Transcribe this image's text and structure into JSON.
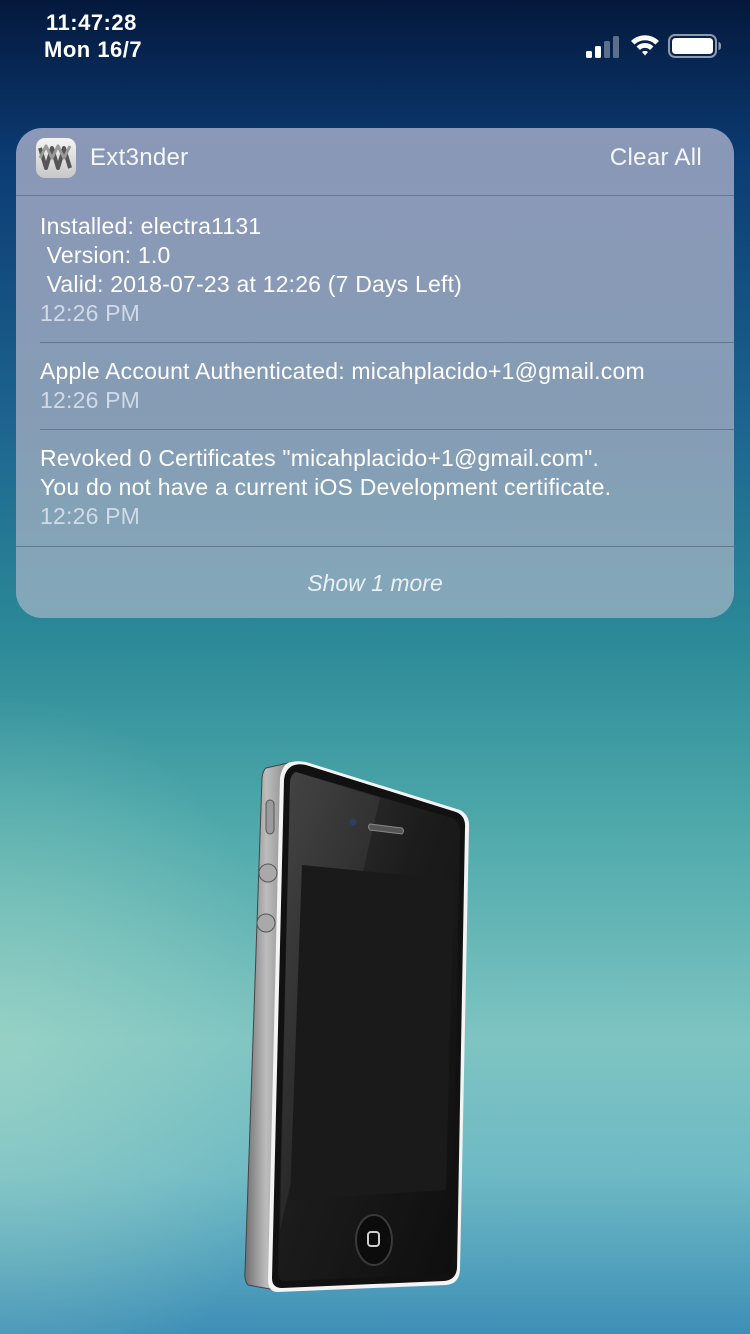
{
  "status_bar": {
    "time": "11:47:28",
    "date": "Mon 16/7",
    "signal_icon": "cellular-signal-icon",
    "wifi_icon": "wifi-icon",
    "battery_icon": "battery-icon"
  },
  "notification": {
    "app_name": "Ext3nder",
    "app_icon": "ext3nder-app-icon",
    "clear_label": "Clear All",
    "entries": [
      {
        "lines": [
          "Installed: electra1131",
          " Version: 1.0",
          " Valid: 2018-07-23 at 12:26 (7 Days Left)"
        ],
        "timestamp": "12:26 PM"
      },
      {
        "lines": [
          "Apple Account Authenticated: micahplacido+1@gmail.com"
        ],
        "timestamp": "12:26 PM"
      },
      {
        "lines": [
          "Revoked 0 Certificates \"micahplacido+1@gmail.com\".",
          "You do not have a current iOS Development certificate."
        ],
        "timestamp": "12:26 PM"
      }
    ],
    "show_more_label": "Show 1 more"
  },
  "wallpaper": {
    "image": "iphone-device-wallpaper-illustration",
    "colors": {
      "top": "#04183c",
      "middle": "#2c8a98",
      "bottom": "#3e8fb7"
    }
  }
}
